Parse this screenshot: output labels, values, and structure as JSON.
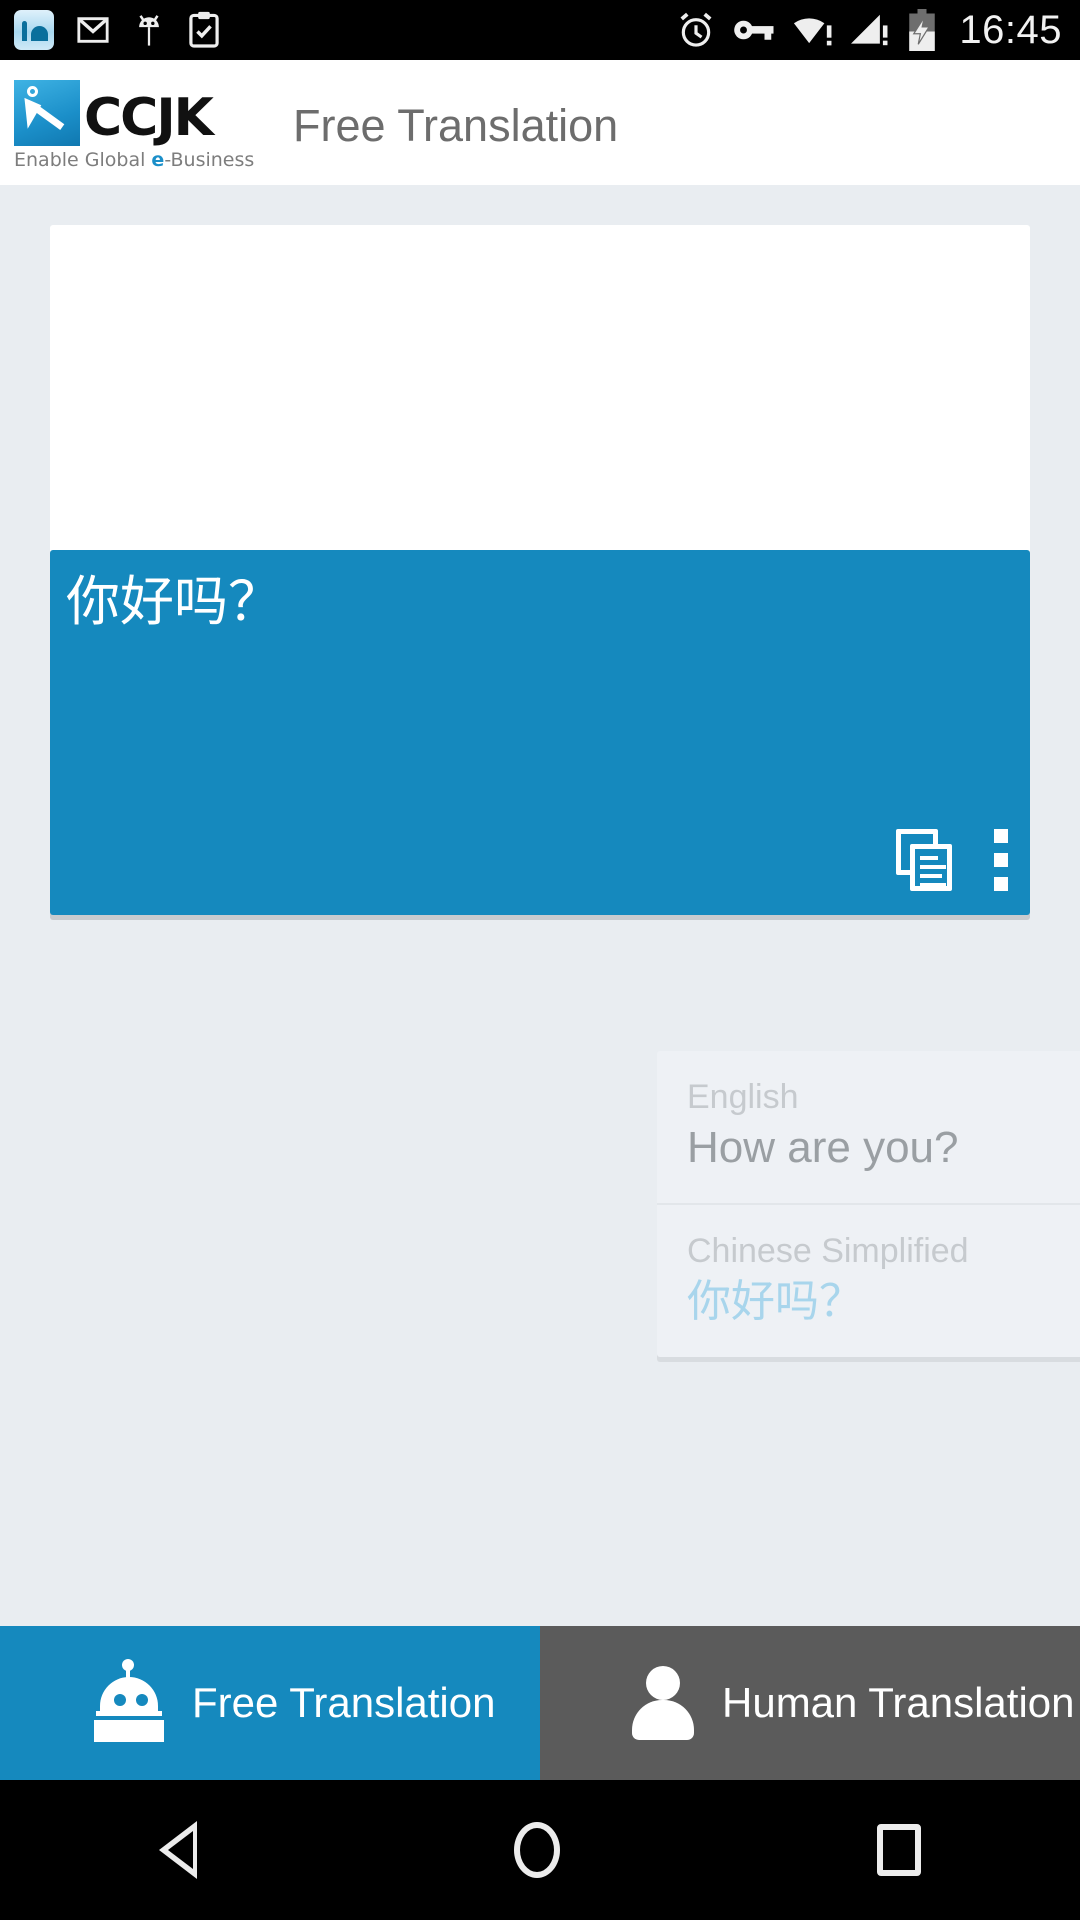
{
  "statusbar": {
    "time": "16:45",
    "left_icons": [
      "prayer-app-icon",
      "gmail-icon",
      "android-bug-icon",
      "clipboard-check-icon"
    ],
    "right_icons": [
      "alarm-clock-icon",
      "vpn-key-icon",
      "wifi-warning-icon",
      "cell-signal-warning-icon",
      "battery-charging-icon"
    ]
  },
  "appbar": {
    "logo_text": "CCJK",
    "logo_tagline_pre": "Enable Global ",
    "logo_tagline_e": "e",
    "logo_tagline_post": "-Business",
    "title": "Free Translation"
  },
  "input_card": {
    "value": "",
    "placeholder": ""
  },
  "output_card": {
    "text": "你好吗？",
    "copy_label": "copy-icon",
    "overflow_label": "overflow-menu-icon",
    "color": "#1589be"
  },
  "history": {
    "items": [
      {
        "lang": "English",
        "text": "How are you?"
      },
      {
        "lang": "Chinese Simplified",
        "text": "你好吗？"
      }
    ]
  },
  "tabs": [
    {
      "label": "Free Translation",
      "icon": "robot-icon",
      "active": true,
      "color": "#1589be"
    },
    {
      "label": "Human Translation",
      "icon": "person-icon",
      "active": false,
      "color": "#5b5b5b"
    }
  ],
  "navbar": {
    "back": "back-icon",
    "home": "home-icon",
    "recents": "recents-icon"
  }
}
